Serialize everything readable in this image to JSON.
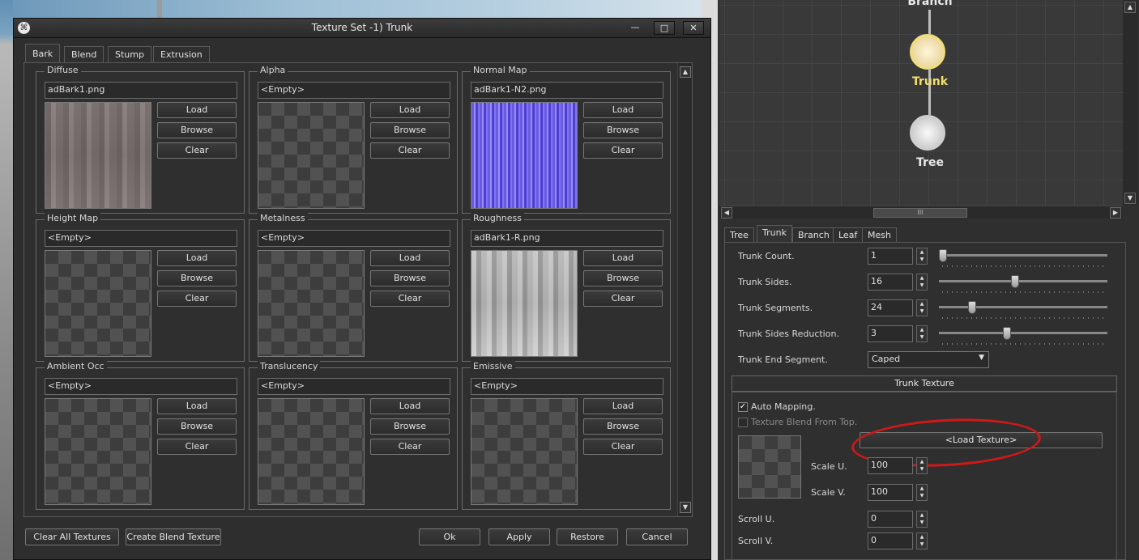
{
  "dialog": {
    "title": "Texture Set -1) Trunk",
    "min_glyph": "—",
    "max_glyph": "□",
    "close_glyph": "✕",
    "tabs": [
      "Bark",
      "Blend",
      "Stump",
      "Extrusion"
    ],
    "active_tab": "Bark",
    "panels": [
      {
        "title": "Diffuse",
        "file": "adBark1.png",
        "preview": "bark"
      },
      {
        "title": "Alpha",
        "file": "<Empty>",
        "preview": "empty"
      },
      {
        "title": "Normal Map",
        "file": "adBark1-N2.png",
        "preview": "normal"
      },
      {
        "title": "Height Map",
        "file": "<Empty>",
        "preview": "empty"
      },
      {
        "title": "Metalness",
        "file": "<Empty>",
        "preview": "empty"
      },
      {
        "title": "Roughness",
        "file": "adBark1-R.png",
        "preview": "rough"
      },
      {
        "title": "Ambient Occ",
        "file": "<Empty>",
        "preview": "empty"
      },
      {
        "title": "Translucency",
        "file": "<Empty>",
        "preview": "empty"
      },
      {
        "title": "Emissive",
        "file": "<Empty>",
        "preview": "empty"
      }
    ],
    "panel_buttons": {
      "load": "Load",
      "browse": "Browse",
      "clear": "Clear"
    },
    "footer": {
      "clear_all": "Clear All Textures",
      "create_blend": "Create Blend Texture",
      "ok": "Ok",
      "apply": "Apply",
      "restore": "Restore",
      "cancel": "Cancel"
    }
  },
  "graph": {
    "nodes": [
      {
        "label": "Branch",
        "active": false
      },
      {
        "label": "Trunk",
        "active": true
      },
      {
        "label": "Tree",
        "active": false
      }
    ],
    "hthumb_glyph": "III"
  },
  "properties": {
    "tabs": [
      "Tree",
      "Trunk",
      "Branch",
      "Leaf",
      "Mesh"
    ],
    "active_tab": "Trunk",
    "rows": [
      {
        "label": "Trunk Count.",
        "value": "1",
        "slider_frac": 0.0
      },
      {
        "label": "Trunk Sides.",
        "value": "16",
        "slider_frac": 0.45
      },
      {
        "label": "Trunk Segments.",
        "value": "24",
        "slider_frac": 0.18
      },
      {
        "label": "Trunk Sides Reduction.",
        "value": "3",
        "slider_frac": 0.4
      }
    ],
    "end_segment_label": "Trunk End Segment.",
    "end_segment_value": "Caped",
    "texture_section_title": "Trunk Texture",
    "auto_mapping_label": "Auto Mapping.",
    "auto_mapping_checked": true,
    "blend_from_top_label": "Texture Blend From Top.",
    "blend_from_top_checked": false,
    "load_texture_label": "<Load Texture>",
    "scale_u_label": "Scale U.",
    "scale_u_value": "100",
    "scale_v_label": "Scale V.",
    "scale_v_value": "100",
    "scroll_u_label": "Scroll U.",
    "scroll_u_value": "0",
    "scroll_v_label": "Scroll V.",
    "scroll_v_value": "0",
    "annotation_color": "#d01818"
  }
}
